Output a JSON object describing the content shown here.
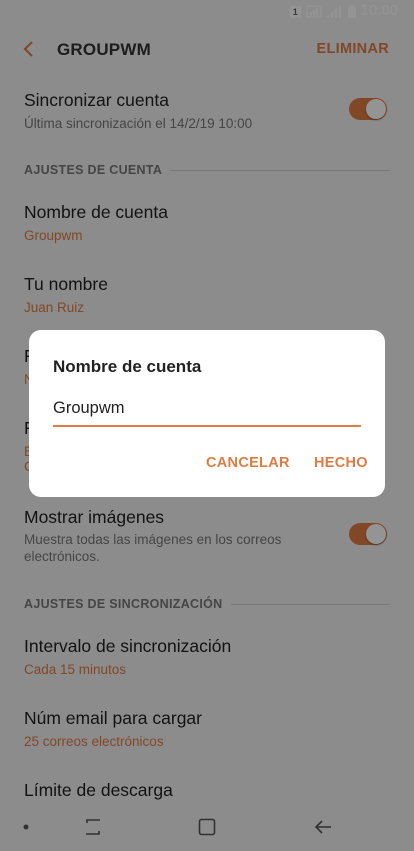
{
  "statusbar": {
    "sim_slot": "1",
    "time": "10.00"
  },
  "appbar": {
    "title": "GROUPWM",
    "action": "ELIMINAR"
  },
  "settings": {
    "sync_account": {
      "title": "Sincronizar cuenta",
      "subtitle": "Última sincronización el 14/2/19  10:00",
      "enabled": true
    },
    "section_account": "AJUSTES DE CUENTA",
    "account_name": {
      "title": "Nombre de cuenta",
      "value": "Groupwm"
    },
    "your_name": {
      "title": "Tu nombre",
      "value": "Juan Ruiz"
    },
    "hidden_row_1": {
      "title": "F",
      "value": "N"
    },
    "hidden_row_2": {
      "title": "F",
      "value_line1": "E",
      "value_line2": "C"
    },
    "show_images": {
      "title": "Mostrar imágenes",
      "subtitle": "Muestra todas las imágenes en los correos electrónicos.",
      "enabled": true
    },
    "section_sync": "AJUSTES DE SINCRONIZACIÓN",
    "sync_interval": {
      "title": "Intervalo de sincronización",
      "value": "Cada 15 minutos"
    },
    "emails_to_load": {
      "title": "Núm email para cargar",
      "value": "25 correos electrónicos"
    },
    "download_limit": {
      "title": "Límite de descarga"
    }
  },
  "dialog": {
    "title": "Nombre de cuenta",
    "input_value": "Groupwm",
    "cancel_label": "CANCELAR",
    "done_label": "HECHO"
  },
  "colors": {
    "accent": "#e07b42",
    "background": "#f2f2f2"
  },
  "icons": {
    "back": "chevron-left-icon",
    "nav_recents": "recents-icon",
    "nav_home": "home-icon",
    "nav_back": "arrow-left-icon"
  }
}
